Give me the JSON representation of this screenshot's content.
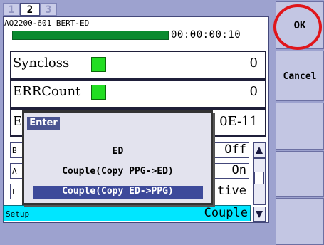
{
  "tabs": [
    "1",
    "2",
    "3"
  ],
  "device_title": "AQ2200-601 BERT-ED",
  "elapsed_time": "00:00:00:10",
  "measurements": {
    "syncloss_label": "Syncloss",
    "syncloss_value": "0",
    "errcount_label": "ERRCount",
    "errcount_value": "0",
    "ber_label_fragment": "E",
    "ber_value_fragment": "0E-11"
  },
  "settings_rows": {
    "row1_name": "B",
    "row1_value": "Off",
    "row2_name": "A",
    "row2_value": "On",
    "row3_name": "L",
    "row3_value": "tive"
  },
  "setup": {
    "label": "Setup",
    "value": "Couple"
  },
  "right_menu": {
    "ok_label": "OK",
    "cancel_label": "Cancel"
  },
  "popup": {
    "header": "Enter",
    "items": [
      "ED",
      "Couple(Copy PPG->ED)",
      "Couple(Copy ED->PPG)"
    ],
    "selected_index": 2
  },
  "colors": {
    "background": "#9da2cf",
    "indicator_green": "#22dd22",
    "setup_cyan": "#00e6ff",
    "selection_blue": "#3d4a9a",
    "highlight_red": "#e0161b"
  },
  "icons": [
    "scroll-up-icon",
    "scroll-down-icon",
    "highlight-circle"
  ]
}
